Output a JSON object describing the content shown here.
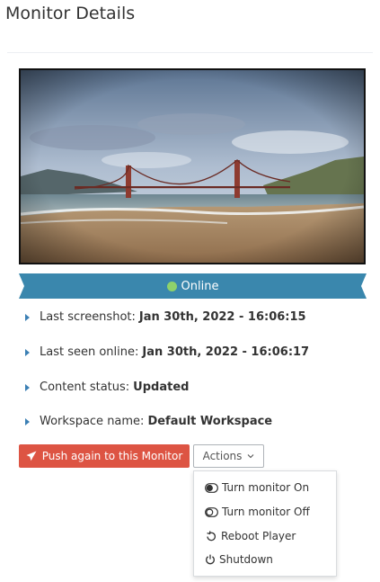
{
  "page": {
    "title": "Monitor Details"
  },
  "screenshot": {
    "description_icon": "monitor-screenshot"
  },
  "status": {
    "label": "Online",
    "color": "#8ed26b",
    "ribbon_color": "#3a87ad"
  },
  "info": [
    {
      "label": "Last screenshot:",
      "value": "Jan 30th, 2022 - 16:06:15"
    },
    {
      "label": "Last seen online:",
      "value": "Jan 30th, 2022 - 16:06:17"
    },
    {
      "label": "Content status:",
      "value": "Updated"
    },
    {
      "label": "Workspace name:",
      "value": "Default Workspace"
    }
  ],
  "buttons": {
    "push_label": "Push again to this Monitor",
    "push_icon": "paper-plane-icon",
    "push_color": "#dd5443",
    "actions_label": "Actions",
    "actions_icon": "chevron-down-icon"
  },
  "actions_menu": [
    {
      "label": "Turn monitor On",
      "icon": "toggle-on-icon"
    },
    {
      "label": "Turn monitor Off",
      "icon": "toggle-off-icon"
    },
    {
      "label": "Reboot Player",
      "icon": "reboot-icon"
    },
    {
      "label": "Shutdown",
      "icon": "power-icon"
    }
  ]
}
